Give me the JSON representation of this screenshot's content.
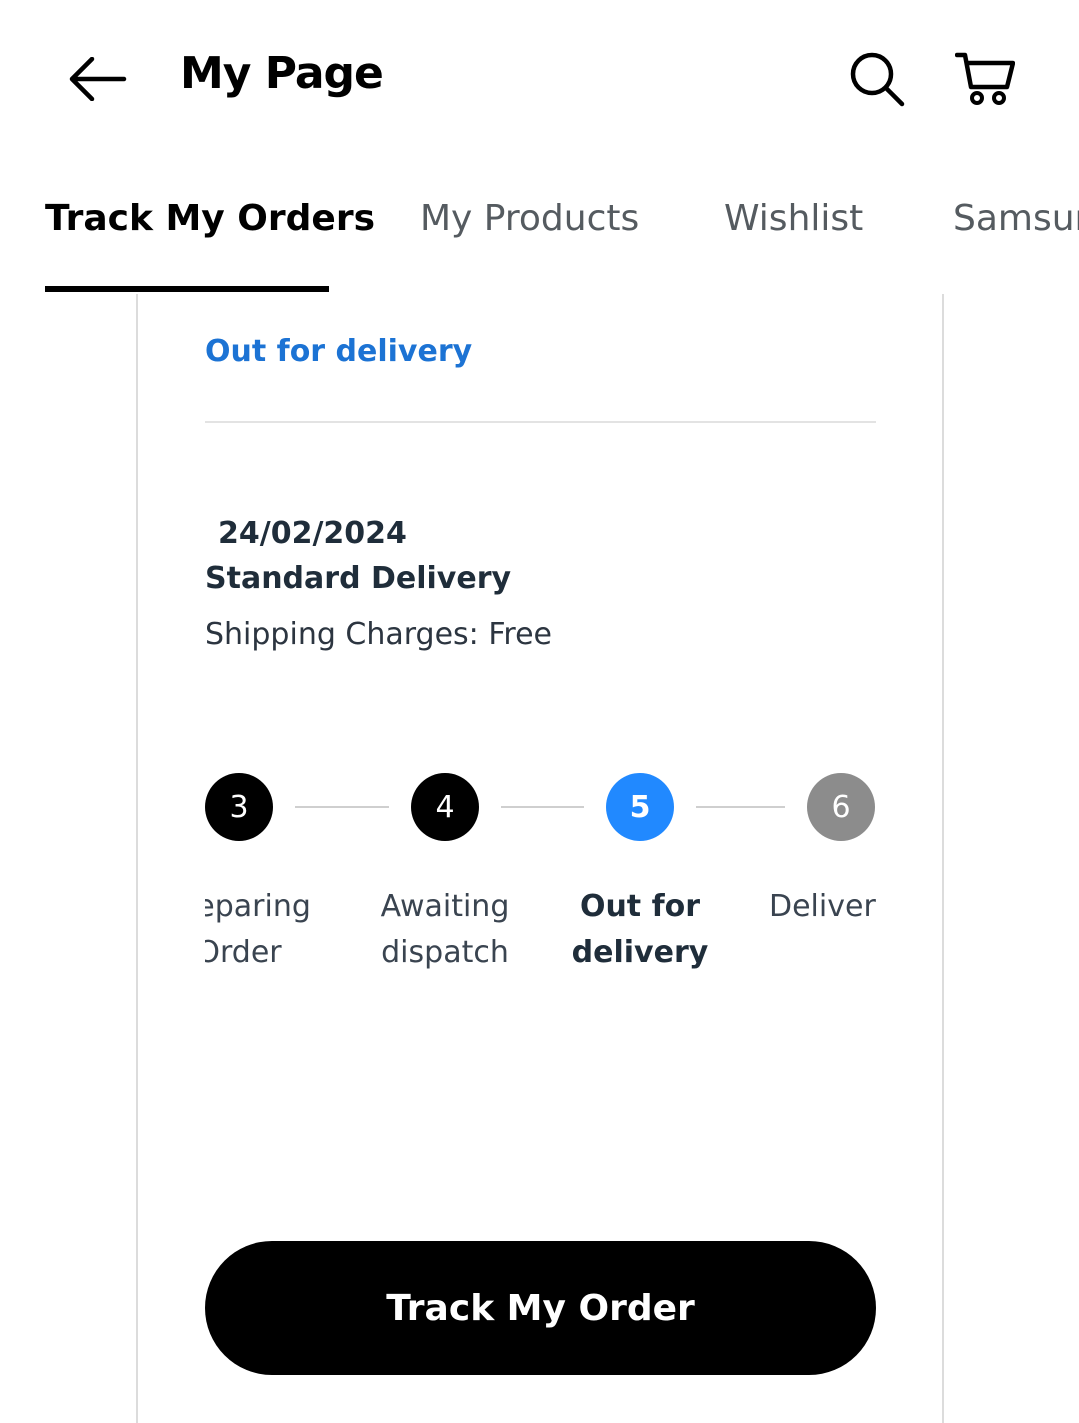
{
  "header": {
    "title": "My Page",
    "back_icon": "arrow-left-icon",
    "search_icon": "search-icon",
    "cart_icon": "cart-icon"
  },
  "tabs": [
    {
      "label": "Track My Orders",
      "active": true
    },
    {
      "label": "My Products",
      "active": false
    },
    {
      "label": "Wishlist",
      "active": false
    },
    {
      "label": "Samsung",
      "active": false
    }
  ],
  "order": {
    "status": "Out for delivery",
    "date": "24/02/2024",
    "delivery_type": "Standard Delivery",
    "shipping_charges": "Shipping Charges: Free"
  },
  "stepper": {
    "steps": [
      {
        "number": "3",
        "label_line1": "Preparing",
        "label_line2": "Order",
        "state": "done"
      },
      {
        "number": "4",
        "label_line1": "Awaiting",
        "label_line2": "dispatch",
        "state": "done"
      },
      {
        "number": "5",
        "label_line1": "Out for",
        "label_line2": "delivery",
        "state": "current"
      },
      {
        "number": "6",
        "label_line1": "Delivered",
        "label_line2": "",
        "state": "pending"
      }
    ],
    "colors": {
      "done": "#000000",
      "current": "#2189ff",
      "pending": "#8c8c8c"
    }
  },
  "actions": {
    "track_button": "Track My Order"
  },
  "colors": {
    "accent": "#1c73d4",
    "primary_text": "#1f2d3a"
  }
}
